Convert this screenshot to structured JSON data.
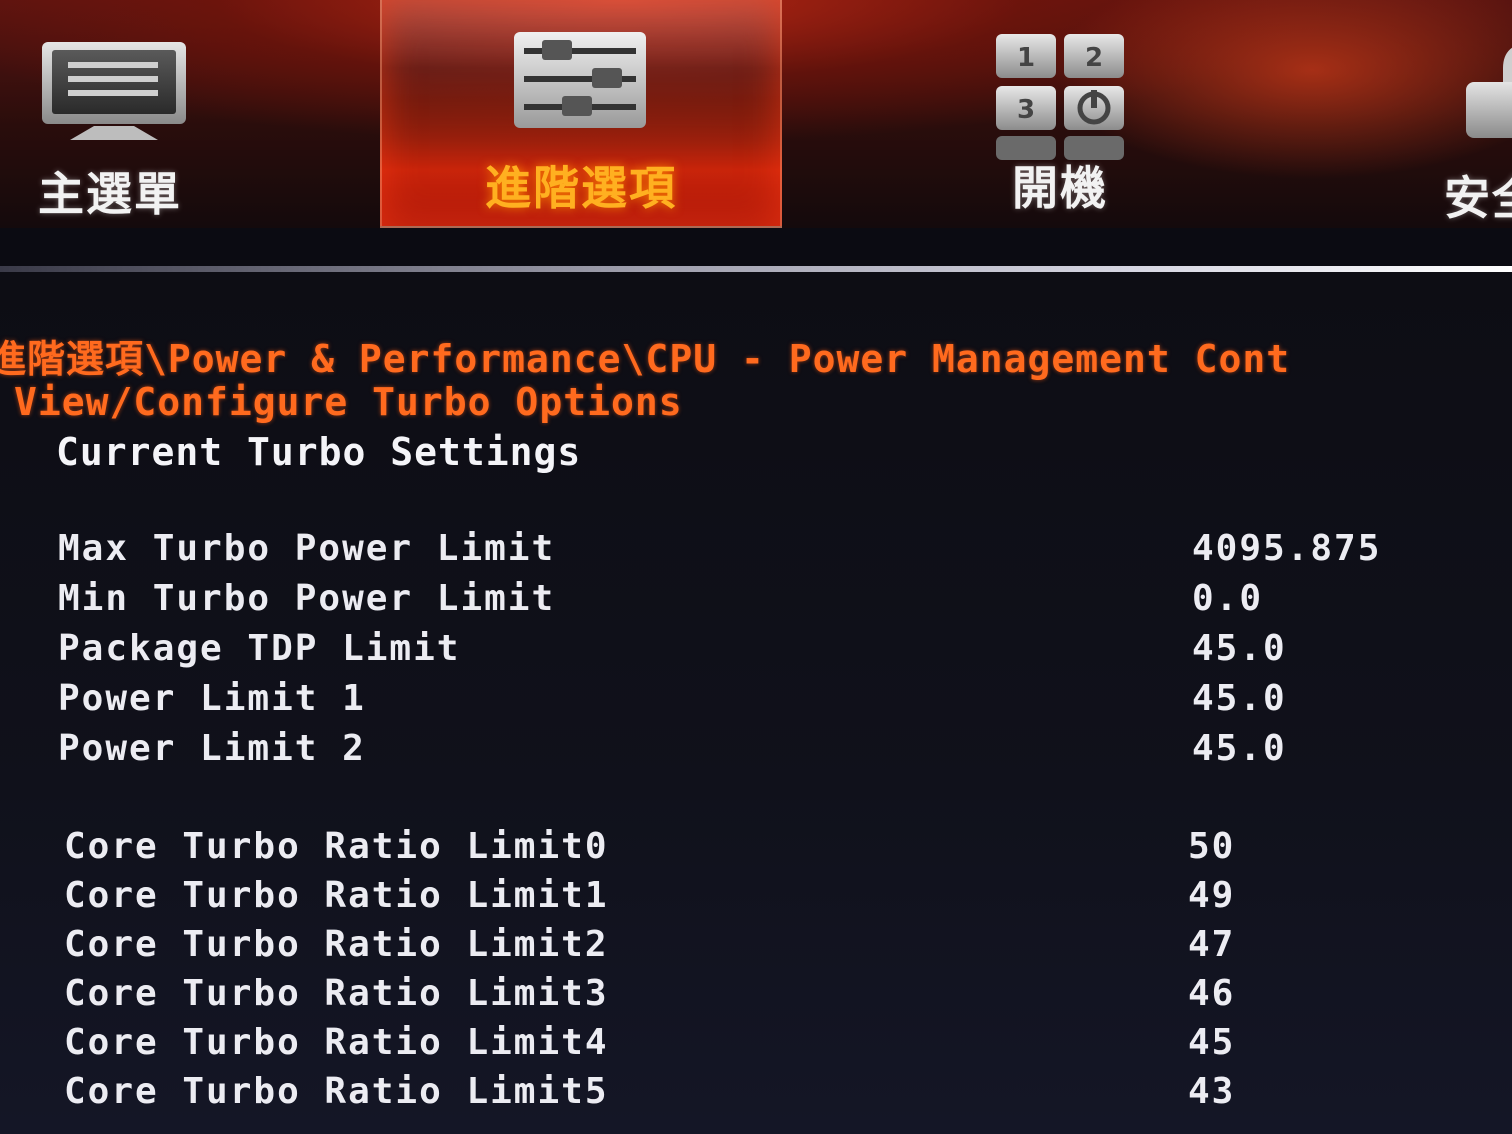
{
  "tabs": [
    {
      "label": "主選單",
      "icon": "monitor-icon"
    },
    {
      "label": "進階選項",
      "icon": "sliders-icon",
      "selected": true
    },
    {
      "label": "開機",
      "icon": "boot-icon"
    },
    {
      "label": "安全",
      "icon": "lock-icon"
    }
  ],
  "breadcrumb": "進階選項\\Power & Performance\\CPU - Power Management Cont",
  "section_title": "View/Configure Turbo Options",
  "subheading": "Current Turbo Settings",
  "power_settings": [
    {
      "label": "Max Turbo Power Limit",
      "value": "4095.875"
    },
    {
      "label": "Min Turbo Power Limit",
      "value": "0.0"
    },
    {
      "label": "Package TDP Limit",
      "value": "45.0"
    },
    {
      "label": "Power Limit 1",
      "value": "45.0"
    },
    {
      "label": "Power Limit 2",
      "value": "45.0"
    }
  ],
  "ratio_settings": [
    {
      "label": "Core Turbo Ratio Limit0",
      "value": "50"
    },
    {
      "label": "Core Turbo Ratio Limit1",
      "value": "49"
    },
    {
      "label": "Core Turbo Ratio Limit2",
      "value": "47"
    },
    {
      "label": "Core Turbo Ratio Limit3",
      "value": "46"
    },
    {
      "label": "Core Turbo Ratio Limit4",
      "value": "45"
    },
    {
      "label": "Core Turbo Ratio Limit5",
      "value": "43"
    }
  ],
  "colors": {
    "accent_orange": "#ff6a1e",
    "selected_tab_text": "#ffb020",
    "text": "#ececf2",
    "background": "#0d0d14"
  }
}
